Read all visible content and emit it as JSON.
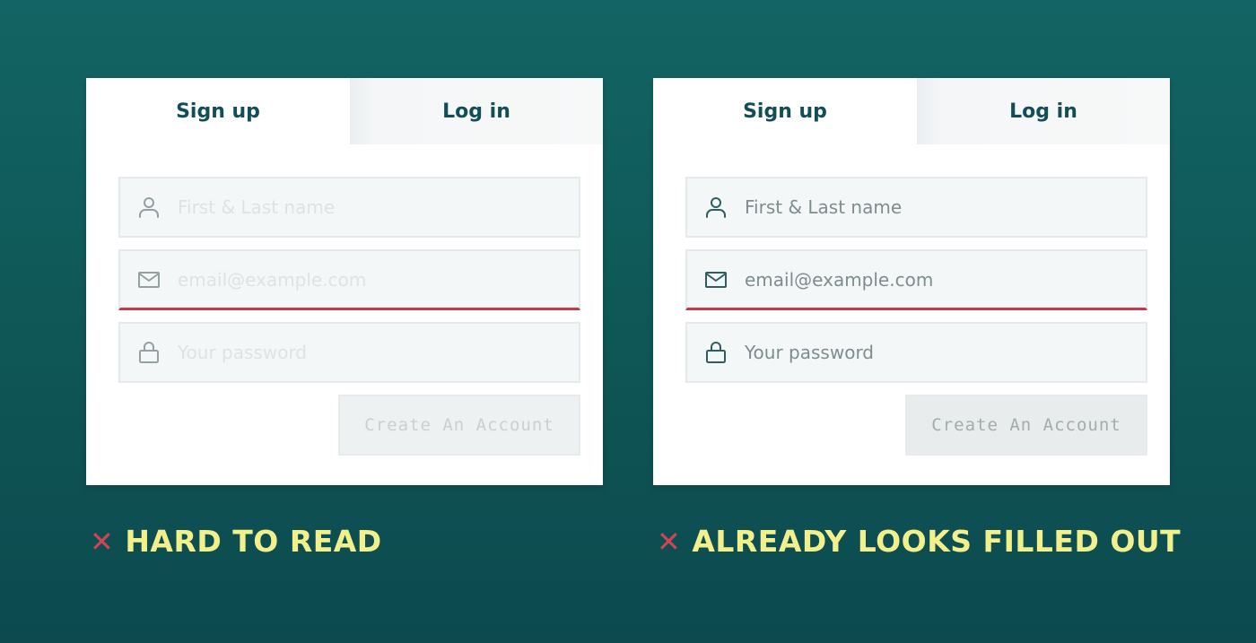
{
  "colors": {
    "background": "#136464",
    "accent_text": "#124e57",
    "error_line": "#c8384b",
    "caption": "#f3ef8a",
    "x_mark": "#d04552"
  },
  "panels": [
    {
      "tabs": {
        "signup": "Sign up",
        "login": "Log in"
      },
      "fields": {
        "name": {
          "placeholder": "First & Last name",
          "icon": "user-icon"
        },
        "email": {
          "placeholder": "email@example.com",
          "icon": "envelope-icon"
        },
        "password": {
          "placeholder": "Your password",
          "icon": "lock-icon"
        }
      },
      "button": "Create An Account",
      "caption": {
        "mark": "✕",
        "text": "HARD TO READ"
      }
    },
    {
      "tabs": {
        "signup": "Sign up",
        "login": "Log in"
      },
      "fields": {
        "name": {
          "placeholder": "First & Last name",
          "icon": "user-icon"
        },
        "email": {
          "placeholder": "email@example.com",
          "icon": "envelope-icon"
        },
        "password": {
          "placeholder": "Your password",
          "icon": "lock-icon"
        }
      },
      "button": "Create An Account",
      "caption": {
        "mark": "✕",
        "text": "ALREADY LOOKS FILLED OUT"
      }
    }
  ]
}
